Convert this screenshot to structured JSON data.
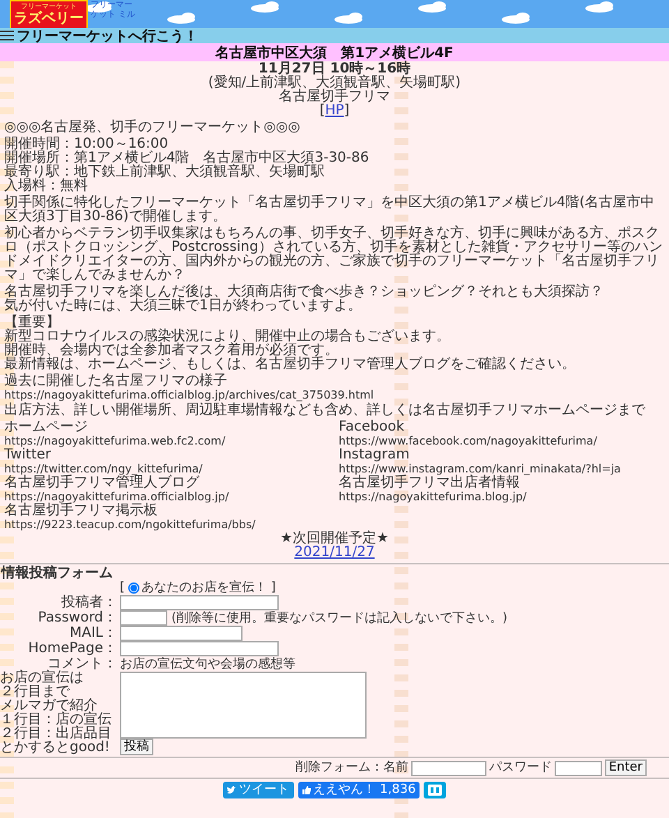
{
  "header": {
    "logo": {
      "line_1": "フリーマーケット",
      "line_2": "ラズベリー"
    },
    "image_alt": "フリーマーケット ミル"
  },
  "nav": {
    "title": "フリーマーケットへ行こう！"
  },
  "venue_bar": {
    "title": "名古屋市中区大須　第1アメ横ビル4F"
  },
  "event": {
    "date": "11月27日 10時～16時",
    "stations": "(愛知/上前津駅、大須観音駅、矢場町駅)",
    "name": "名古屋切手フリマ",
    "link_open": "[",
    "link": "HP",
    "link_close": "]"
  },
  "paragraphs": [
    [
      "◎◎◎名古屋発、切手のフリーマーケット◎◎◎"
    ],
    [
      "開催時間：10:00～16:00",
      "開催場所：第1アメ横ビル4階　名古屋市中区大須3-30-86",
      "最寄り駅：地下鉄上前津駅、大須観音駅、矢場町駅",
      "入場料：無料"
    ],
    [
      "切手関係に特化したフリーマーケット「名古屋切手フリマ」を中区大須の第1アメ横ビル4階(名古屋市中区大須3丁目30-86)で開催します。"
    ],
    [
      "初心者からベテラン切手収集家はもちろんの事、切手女子、切手好きな方、切手に興味がある方、ポスクロ（ポストクロッシング、Postcrossing）されている方、切手を素材とした雑貨・アクセサリー等のハンドメイドクリエイターの方、国内外からの観光の方、ご家族で切手のフリーマーケット「名古屋切手フリマ」で楽しんでみませんか？"
    ],
    [
      "名古屋切手フリマを楽しんだ後は、大須商店街で食べ歩き？ショッピング？それとも大須探訪？",
      "気が付いた時には、大須三昧で1日が終わっていますよ。"
    ],
    [
      "【重要】",
      "新型コロナウイルスの感染状況により、開催中止の場合もございます。",
      "開催時、会場内では全参加者マスク着用が必須です。",
      "最新情報は、ホームページ、もしくは、名古屋切手フリマ管理人ブログをご確認ください。"
    ],
    [
      "過去に開催した名古屋フリマの様子",
      "https://nagoyakittefurima.officialblog.jp/archives/cat_375039.html"
    ],
    [
      "出店方法、詳しい開催場所、周辺駐車場情報なども含め、詳しくは名古屋切手フリマホームページまで"
    ]
  ],
  "links": [
    {
      "label": "ホームページ",
      "url": "https://nagoyakittefurima.web.fc2.com/"
    },
    {
      "label": "Facebook",
      "url": "https://www.facebook.com/nagoyakittefurima/"
    },
    {
      "label": "Twitter",
      "url": "https://twitter.com/ngy_kittefurima/"
    },
    {
      "label": "Instagram",
      "url": "https://www.instagram.com/kanri_minakata/?hl=ja"
    },
    {
      "label": "名古屋切手フリマ管理人ブログ",
      "url": "https://nagoyakittefurima.officialblog.jp/"
    },
    {
      "label": "名古屋切手フリマ出店者情報",
      "url": "https://nagoyakittefurima.blog.jp/"
    },
    {
      "label": "名古屋切手フリマ掲示板",
      "url": "https://9223.teacup.com/ngokittefurima/bbs/"
    }
  ],
  "next": {
    "label": "★次回開催予定★",
    "date": "2021/11/27"
  },
  "form": {
    "title": "情報投稿フォーム",
    "bracket_open": "[",
    "bracket_close": "]",
    "radio": {
      "label": "あなたのお店を宣伝！",
      "selected": true
    },
    "fields": [
      {
        "label": "投稿者：",
        "kind": "wide"
      },
      {
        "label": "Password：",
        "kind": "short",
        "note": "(削除等に使用。重要なパスワードは記入しないで下さい。)"
      },
      {
        "label": "MAIL：",
        "kind": "medium"
      },
      {
        "label": "HomePage：",
        "kind": "wide"
      }
    ],
    "comment": {
      "label": "コメント：",
      "hint": "お店の宣伝文句や会場の感想等",
      "note": [
        "お店の宣伝は",
        "２行目まで",
        "メルマガで紹介",
        "１行目：店の宣伝",
        "２行目：出店品目",
        "とかするとgood!"
      ]
    },
    "submit": "投稿"
  },
  "delete_form": {
    "name_label": "削除フォーム：名前",
    "password_label": "パスワード",
    "submit": "Enter"
  },
  "share": [
    {
      "kind": "tweet",
      "label": "ツイート"
    },
    {
      "kind": "like",
      "label": "ええやん！ 1,836"
    },
    {
      "kind": "bookmark"
    }
  ]
}
